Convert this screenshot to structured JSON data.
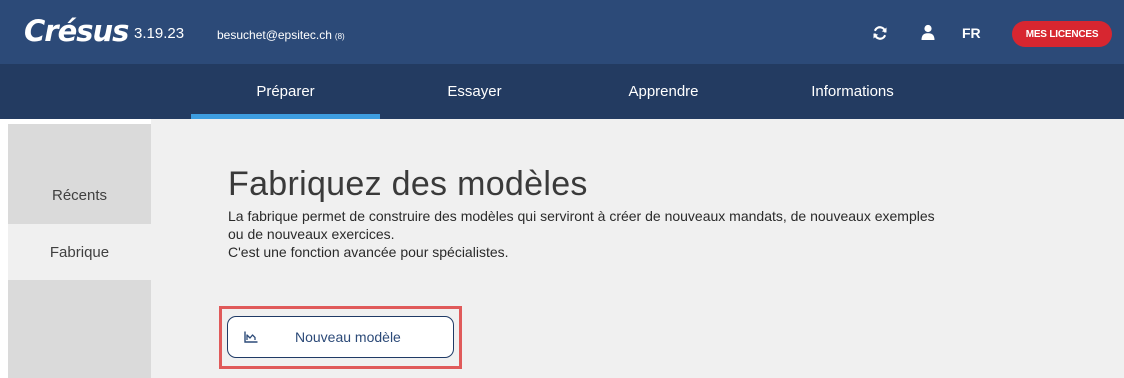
{
  "header": {
    "logo_text": "Crésus",
    "version": "3.19.23",
    "email": "besuchet@epsitec.ch",
    "email_count": "(8)",
    "language": "FR",
    "licences_button": "MES LICENCES",
    "refresh_icon": "refresh-icon",
    "user_icon": "user-icon"
  },
  "nav": {
    "tabs": [
      {
        "label": "Préparer",
        "active": true
      },
      {
        "label": "Essayer",
        "active": false
      },
      {
        "label": "Apprendre",
        "active": false
      },
      {
        "label": "Informations",
        "active": false
      }
    ]
  },
  "sidebar": {
    "items": [
      {
        "label": "Récents",
        "active": false
      },
      {
        "label": "Fabrique",
        "active": true
      }
    ]
  },
  "main": {
    "title": "Fabriquez des modèles",
    "description_line1": "La fabrique permet de construire des modèles qui serviront à créer de nouveaux mandats, de nouveaux exemples",
    "description_line2": "ou de nouveaux exercices.",
    "description_line3": "C'est une fonction avancée pour spécialistes.",
    "new_model_button": "Nouveau modèle",
    "new_model_icon": "chart-icon"
  },
  "colors": {
    "header_bg": "#2c4a78",
    "nav_bg": "#233b61",
    "active_tab_accent": "#3d9de0",
    "licences_button_bg": "#d72630",
    "highlight_border": "#e05a5a",
    "content_bg": "#f0f0f0",
    "sidebar_bg": "#dadada"
  }
}
